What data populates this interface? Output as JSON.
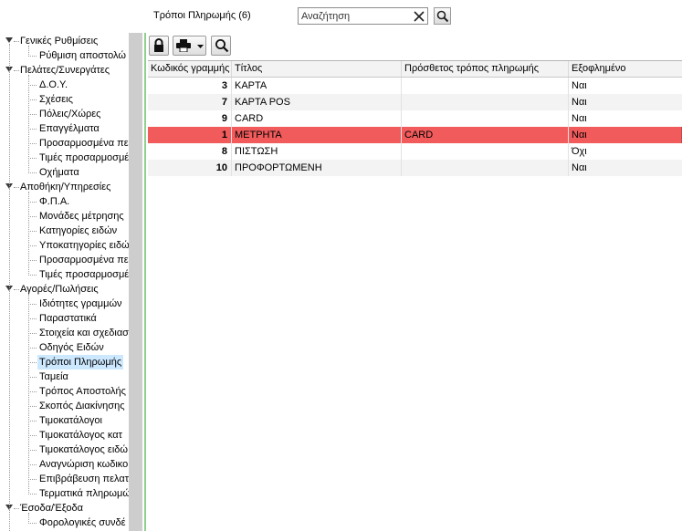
{
  "header": {
    "title": "Τρόποι Πληρωμής (6)",
    "search_placeholder": "Αναζήτηση",
    "search_value": ""
  },
  "icons": {
    "search": "search-icon",
    "clear": "close-icon",
    "lock": "lock-icon",
    "print": "printer-icon",
    "dropdown": "chevron-down-icon",
    "find": "search-icon"
  },
  "tree": {
    "items": [
      {
        "label": "Γενικές Ρυθμίσεις",
        "level": 0
      },
      {
        "label": "Ρύθμιση αποστολώ",
        "level": 1
      },
      {
        "label": "Πελάτες/Συνεργάτες",
        "level": 0
      },
      {
        "label": "Δ.Ο.Υ.",
        "level": 1
      },
      {
        "label": "Σχέσεις",
        "level": 1
      },
      {
        "label": "Πόλεις/Χώρες",
        "level": 1
      },
      {
        "label": "Επαγγέλματα",
        "level": 1
      },
      {
        "label": "Προσαρμοσμένα πε",
        "level": 1
      },
      {
        "label": "Τιμές προσαρμοσμέ",
        "level": 1
      },
      {
        "label": "Οχήματα",
        "level": 1
      },
      {
        "label": "Αποθήκη/Υπηρεσίες",
        "level": 0
      },
      {
        "label": "Φ.Π.Α.",
        "level": 1
      },
      {
        "label": "Μονάδες μέτρησης",
        "level": 1
      },
      {
        "label": "Κατηγορίες ειδών",
        "level": 1
      },
      {
        "label": "Υποκατηγορίες ειδώ",
        "level": 1
      },
      {
        "label": "Προσαρμοσμένα πε",
        "level": 1
      },
      {
        "label": "Τιμές προσαρμοσμέ",
        "level": 1
      },
      {
        "label": "Αγορές/Πωλήσεις",
        "level": 0
      },
      {
        "label": "Ιδιότητες γραμμών",
        "level": 1
      },
      {
        "label": "Παραστατικά",
        "level": 1
      },
      {
        "label": "Στοιχεία και σχεδιασ",
        "level": 1
      },
      {
        "label": "Οδηγός Ειδών",
        "level": 1
      },
      {
        "label": "Τρόποι Πληρωμής",
        "level": 1,
        "selected": true
      },
      {
        "label": "Ταμεία",
        "level": 1
      },
      {
        "label": "Τρόπος Αποστολής",
        "level": 1
      },
      {
        "label": "Σκοπός Διακίνησης",
        "level": 1
      },
      {
        "label": "Τιμοκατάλογοι",
        "level": 1
      },
      {
        "label": "Τιμοκατάλογος κατ",
        "level": 1
      },
      {
        "label": "Τιμοκατάλογος ειδώ",
        "level": 1
      },
      {
        "label": "Αναγνώριση κωδικο",
        "level": 1
      },
      {
        "label": "Επιβράβευση πελατ",
        "level": 1
      },
      {
        "label": "Τερματικά πληρωμώ",
        "level": 1
      },
      {
        "label": "Έσοδα/Έξοδα",
        "level": 0
      },
      {
        "label": "Φορολογικές συνδέ",
        "level": 1
      }
    ]
  },
  "grid": {
    "columns": [
      "Κωδικός γραμμής",
      "Τίτλος",
      "Πρόσθετος τρόπος πληρωμής",
      "Εξοφλημένο"
    ],
    "rows": [
      {
        "code": "3",
        "title": "ΚΑΡΤΑ",
        "extra": "",
        "paid": "Ναι"
      },
      {
        "code": "7",
        "title": "ΚΑΡΤΑ POS",
        "extra": "",
        "paid": "Ναι"
      },
      {
        "code": "9",
        "title": "CARD",
        "extra": "",
        "paid": "Ναι"
      },
      {
        "code": "1",
        "title": "ΜΕΤΡΗΤΑ",
        "extra": "CARD",
        "paid": "Ναι",
        "highlight": true
      },
      {
        "code": "8",
        "title": "ΠΙΣΤΩΣΗ",
        "extra": "",
        "paid": "Όχι"
      },
      {
        "code": "10",
        "title": "ΠΡΟΦΟΡΤΩΜΕΝΗ",
        "extra": "",
        "paid": "Ναι"
      }
    ]
  },
  "colors": {
    "highlight_row": "#f15b5b",
    "selected_tree_item": "#cce8ff",
    "splitter_accent": "#8fcf8f"
  }
}
